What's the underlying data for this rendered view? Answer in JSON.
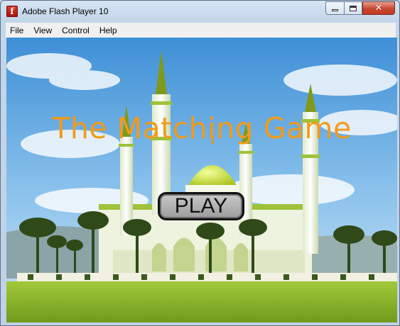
{
  "window": {
    "title": "Adobe Flash Player 10"
  },
  "menu": {
    "items": [
      "File",
      "View",
      "Control",
      "Help"
    ]
  },
  "game": {
    "title": "The Matching Game",
    "play_label": "PLAY"
  },
  "colors": {
    "title": "#f29a1a",
    "sky": "#6aaee3",
    "grass": "#8bb62a"
  }
}
